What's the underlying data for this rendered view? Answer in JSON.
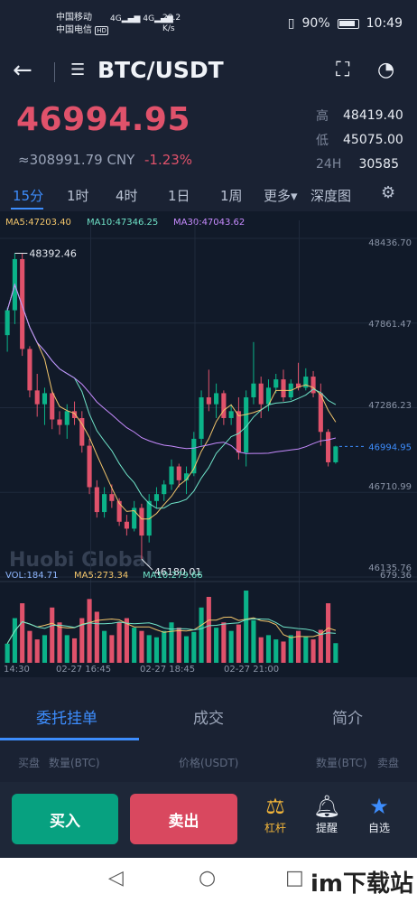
{
  "status_bar": {
    "carrier1": "中国移动",
    "carrier2": "中国电信",
    "hd": "HD",
    "net1": "4G",
    "net2": "4G",
    "speed_value": "28.2",
    "speed_unit": "K/s",
    "battery": "90%",
    "time": "10:49"
  },
  "header": {
    "pair": "BTC/USDT"
  },
  "price": {
    "last": "46994.95",
    "cny": "≈308991.79 CNY",
    "change": "-1.23%",
    "stats": [
      {
        "label": "高",
        "value": "48419.40"
      },
      {
        "label": "低",
        "value": "45075.00"
      },
      {
        "label": "24H",
        "value": "30585"
      }
    ]
  },
  "timeframes": [
    "15分",
    "1时",
    "4时",
    "1日",
    "1周",
    "更多▾",
    "深度图"
  ],
  "ma": {
    "ma5": "MA5:47203.40",
    "ma10": "MA10:47346.25",
    "ma30": "MA30:47043.62"
  },
  "vol": {
    "vol": "VOL:184.71",
    "ma5": "MA5:273.34",
    "ma10": "MA10:279.66",
    "max": "679.36"
  },
  "colors": {
    "up": "#0bb389",
    "down": "#e0526b",
    "ma5": "#f2c56b",
    "ma10": "#6fe3c8",
    "ma30": "#c78bff",
    "accent": "#3d8dfd"
  },
  "chart_data": {
    "type": "candlestick",
    "y_axis_labels": [
      "48436.70",
      "47861.47",
      "47286.23",
      "46710.99",
      "46135.76"
    ],
    "current_price_label": "46994.95",
    "high_marker": "48392.46",
    "low_marker": "46180.01",
    "x_labels": [
      "14:30",
      "02-27 16:45",
      "02-27 18:45",
      "02-27 21:00"
    ],
    "ylim": [
      46050,
      48500
    ],
    "candles": [
      {
        "o": 47800,
        "h": 48000,
        "l": 47680,
        "c": 47980
      },
      {
        "o": 47980,
        "h": 48392.46,
        "l": 47880,
        "c": 48350
      },
      {
        "o": 48350,
        "h": 48390,
        "l": 47650,
        "c": 47700
      },
      {
        "o": 47700,
        "h": 47720,
        "l": 47350,
        "c": 47400
      },
      {
        "o": 47400,
        "h": 47520,
        "l": 47210,
        "c": 47300
      },
      {
        "o": 47300,
        "h": 47420,
        "l": 47150,
        "c": 47380
      },
      {
        "o": 47380,
        "h": 47400,
        "l": 47120,
        "c": 47190
      },
      {
        "o": 47190,
        "h": 47250,
        "l": 47080,
        "c": 47150
      },
      {
        "o": 47150,
        "h": 47300,
        "l": 47050,
        "c": 47250
      },
      {
        "o": 47250,
        "h": 47320,
        "l": 47150,
        "c": 47200
      },
      {
        "o": 47200,
        "h": 47250,
        "l": 46950,
        "c": 47000
      },
      {
        "o": 47000,
        "h": 47050,
        "l": 46650,
        "c": 46700
      },
      {
        "o": 46700,
        "h": 46750,
        "l": 46480,
        "c": 46520
      },
      {
        "o": 46520,
        "h": 46700,
        "l": 46480,
        "c": 46650
      },
      {
        "o": 46650,
        "h": 46720,
        "l": 46550,
        "c": 46600
      },
      {
        "o": 46600,
        "h": 46620,
        "l": 46420,
        "c": 46450
      },
      {
        "o": 46450,
        "h": 46500,
        "l": 46350,
        "c": 46400
      },
      {
        "o": 46400,
        "h": 46600,
        "l": 46380,
        "c": 46550
      },
      {
        "o": 46550,
        "h": 46580,
        "l": 46180.01,
        "c": 46350
      },
      {
        "o": 46350,
        "h": 46650,
        "l": 46300,
        "c": 46600
      },
      {
        "o": 46600,
        "h": 46700,
        "l": 46550,
        "c": 46650
      },
      {
        "o": 46650,
        "h": 46750,
        "l": 46600,
        "c": 46720
      },
      {
        "o": 46720,
        "h": 46900,
        "l": 46680,
        "c": 46850
      },
      {
        "o": 46850,
        "h": 46870,
        "l": 46700,
        "c": 46750
      },
      {
        "o": 46750,
        "h": 46850,
        "l": 46650,
        "c": 46800
      },
      {
        "o": 46800,
        "h": 47100,
        "l": 46780,
        "c": 47050
      },
      {
        "o": 47050,
        "h": 47400,
        "l": 47000,
        "c": 47350
      },
      {
        "o": 47350,
        "h": 47550,
        "l": 47250,
        "c": 47300
      },
      {
        "o": 47300,
        "h": 47450,
        "l": 47200,
        "c": 47380
      },
      {
        "o": 47380,
        "h": 47400,
        "l": 47150,
        "c": 47200
      },
      {
        "o": 47200,
        "h": 47300,
        "l": 47150,
        "c": 47250
      },
      {
        "o": 47250,
        "h": 47350,
        "l": 46900,
        "c": 46950
      },
      {
        "o": 46950,
        "h": 47400,
        "l": 46850,
        "c": 47350
      },
      {
        "o": 47350,
        "h": 47750,
        "l": 47300,
        "c": 47450
      },
      {
        "o": 47450,
        "h": 47500,
        "l": 47200,
        "c": 47300
      },
      {
        "o": 47300,
        "h": 47480,
        "l": 47250,
        "c": 47420
      },
      {
        "o": 47420,
        "h": 47520,
        "l": 47380,
        "c": 47480
      },
      {
        "o": 47480,
        "h": 47550,
        "l": 47320,
        "c": 47350
      },
      {
        "o": 47350,
        "h": 47480,
        "l": 47330,
        "c": 47450
      },
      {
        "o": 47450,
        "h": 47600,
        "l": 47400,
        "c": 47420
      },
      {
        "o": 47420,
        "h": 47560,
        "l": 47400,
        "c": 47500
      },
      {
        "o": 47500,
        "h": 47540,
        "l": 47350,
        "c": 47380
      },
      {
        "o": 47380,
        "h": 47450,
        "l": 47000,
        "c": 47100
      },
      {
        "o": 47100,
        "h": 47120,
        "l": 46850,
        "c": 46880
      },
      {
        "o": 46880,
        "h": 47000,
        "l": 46870,
        "c": 46994.95
      }
    ],
    "volumes": [
      180,
      420,
      560,
      300,
      220,
      260,
      520,
      380,
      260,
      230,
      420,
      600,
      480,
      300,
      260,
      380,
      420,
      330,
      300,
      260,
      240,
      300,
      380,
      330,
      250,
      290,
      520,
      620,
      330,
      380,
      300,
      360,
      679.36,
      400,
      240,
      260,
      220,
      200,
      260,
      300,
      250,
      220,
      310,
      560,
      184.71
    ]
  },
  "tabs": [
    "委托挂单",
    "成交",
    "简介"
  ],
  "orderbook_header": {
    "buy_side": "买盘",
    "amount_left": "数量(BTC)",
    "price": "价格(USDT)",
    "amount_right": "数量(BTC)",
    "sell_side": "卖盘"
  },
  "actions": {
    "buy": "买入",
    "sell": "卖出",
    "leverage": "杠杆",
    "alert": "提醒",
    "favorite": "自选"
  },
  "watermark": "Huobi Global",
  "site_watermark": "im下载站"
}
